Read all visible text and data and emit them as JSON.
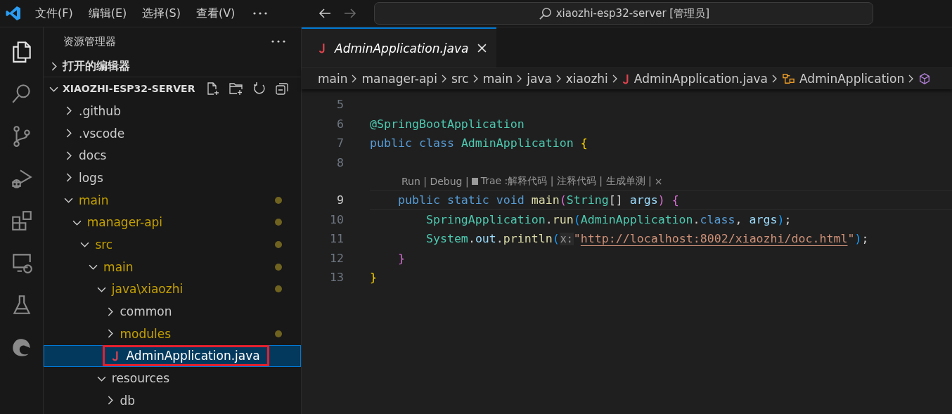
{
  "titlebar": {
    "menu": [
      "文件(F)",
      "编辑(E)",
      "选择(S)",
      "查看(V)"
    ],
    "search": {
      "value": "xiaozhi-esp32-server [管理员]"
    }
  },
  "activity_bar": [
    {
      "kind": "explorer",
      "selected": true
    },
    {
      "kind": "search",
      "selected": false
    },
    {
      "kind": "source-control",
      "selected": false
    },
    {
      "kind": "run-debug",
      "selected": false
    },
    {
      "kind": "extensions",
      "selected": false
    },
    {
      "kind": "remote",
      "selected": false
    },
    {
      "kind": "testing",
      "selected": false
    },
    {
      "kind": "edge",
      "selected": false
    }
  ],
  "explorer": {
    "title": "资源管理器",
    "open_editors": {
      "label": "打开的编辑器",
      "expanded": false
    },
    "workspace": {
      "label": "XIAOZHI-ESP32-SERVER",
      "expanded": true
    },
    "tree": [
      {
        "name": ".github",
        "kind": "folder",
        "expanded": false,
        "modified": false
      },
      {
        "name": ".vscode",
        "kind": "folder",
        "expanded": false,
        "modified": false
      },
      {
        "name": "docs",
        "kind": "folder",
        "expanded": false,
        "modified": false
      },
      {
        "name": "logs",
        "kind": "folder",
        "expanded": false,
        "modified": false
      },
      {
        "name": "main",
        "kind": "folder",
        "expanded": true,
        "modified": true,
        "children": [
          {
            "name": "manager-api",
            "kind": "folder",
            "expanded": true,
            "modified": true,
            "children": [
              {
                "name": "src",
                "kind": "folder",
                "expanded": true,
                "modified": true,
                "children": [
                  {
                    "name": "main",
                    "kind": "folder",
                    "expanded": true,
                    "modified": true,
                    "children": [
                      {
                        "name": "java\\xiaozhi",
                        "kind": "folder",
                        "expanded": true,
                        "modified": true,
                        "children": [
                          {
                            "name": "common",
                            "kind": "folder",
                            "expanded": false,
                            "modified": false
                          },
                          {
                            "name": "modules",
                            "kind": "folder",
                            "expanded": false,
                            "modified": true
                          },
                          {
                            "name": "AdminApplication.java",
                            "kind": "java-file",
                            "selected": true,
                            "highlighted": true
                          }
                        ]
                      },
                      {
                        "name": "resources",
                        "kind": "folder",
                        "expanded": true,
                        "modified": false,
                        "children": [
                          {
                            "name": "db",
                            "kind": "folder",
                            "expanded": false,
                            "modified": false
                          }
                        ]
                      }
                    ]
                  }
                ]
              }
            ]
          }
        ]
      }
    ]
  },
  "tabs": [
    {
      "label": "AdminApplication.java",
      "selected": true,
      "preview": true
    }
  ],
  "breadcrumbs": [
    {
      "label": "main",
      "kind": "folder"
    },
    {
      "label": "manager-api",
      "kind": "folder"
    },
    {
      "label": "src",
      "kind": "folder"
    },
    {
      "label": "main",
      "kind": "folder"
    },
    {
      "label": "java",
      "kind": "folder"
    },
    {
      "label": "xiaozhi",
      "kind": "folder"
    },
    {
      "label": "AdminApplication.java",
      "kind": "java-file"
    },
    {
      "label": "AdminApplication",
      "kind": "class"
    },
    {
      "kind": "method"
    }
  ],
  "editor": {
    "lines": [
      {
        "kind": "code",
        "number": "5",
        "current": false
      },
      {
        "kind": "code",
        "number": "6",
        "current": false,
        "tokens": [
          {
            "text": "@SpringBootApplication",
            "kind": "type"
          }
        ]
      },
      {
        "kind": "code",
        "number": "7",
        "current": false,
        "tokens": [
          {
            "text": "public class ",
            "kind": "keyword"
          },
          {
            "text": "AdminApplication ",
            "kind": "type"
          },
          {
            "text": "{",
            "kind": "brace1"
          }
        ]
      },
      {
        "kind": "code",
        "number": "8",
        "current": false
      },
      {
        "kind": "codelens",
        "parts": [
          "Run | Debug |",
          "Trae :解释代码 | 注释代码 | 生成单测 |"
        ],
        "close": "×"
      },
      {
        "kind": "code",
        "number": "9",
        "current": true,
        "tokens": [
          {
            "text": "    public static void ",
            "kind": "keyword"
          },
          {
            "text": "main",
            "kind": "func"
          },
          {
            "text": "(",
            "kind": "brace2"
          },
          {
            "text": "String",
            "kind": "type"
          },
          {
            "text": "[] ",
            "kind": "plain"
          },
          {
            "text": "args",
            "kind": "var"
          },
          {
            "text": ") ",
            "kind": "brace2"
          },
          {
            "text": "{",
            "kind": "brace2"
          }
        ]
      },
      {
        "kind": "code",
        "number": "10",
        "current": false,
        "tokens": [
          {
            "text": "        SpringApplication",
            "kind": "type"
          },
          {
            "text": ".",
            "kind": "plain"
          },
          {
            "text": "run",
            "kind": "func"
          },
          {
            "text": "(",
            "kind": "brace3"
          },
          {
            "text": "AdminApplication",
            "kind": "type"
          },
          {
            "text": ".",
            "kind": "plain"
          },
          {
            "text": "class",
            "kind": "keyword"
          },
          {
            "text": ", ",
            "kind": "plain"
          },
          {
            "text": "args",
            "kind": "var"
          },
          {
            "text": ")",
            "kind": "brace3"
          },
          {
            "text": ";",
            "kind": "plain"
          }
        ]
      },
      {
        "kind": "code",
        "number": "11",
        "current": false,
        "tokens": [
          {
            "text": "        System",
            "kind": "type"
          },
          {
            "text": ".",
            "kind": "plain"
          },
          {
            "text": "out",
            "kind": "var"
          },
          {
            "text": ".",
            "kind": "plain"
          },
          {
            "text": "println",
            "kind": "func"
          },
          {
            "text": "(",
            "kind": "brace3"
          },
          {
            "text": "x:",
            "kind": "hint"
          },
          {
            "text": "\"",
            "kind": "string"
          },
          {
            "text": "http://localhost:8002/xiaozhi/doc.html",
            "kind": "link"
          },
          {
            "text": "\"",
            "kind": "string"
          },
          {
            "text": ")",
            "kind": "brace3"
          },
          {
            "text": ";",
            "kind": "plain"
          }
        ]
      },
      {
        "kind": "code",
        "number": "12",
        "current": false,
        "tokens": [
          {
            "text": "    }",
            "kind": "brace2"
          }
        ]
      },
      {
        "kind": "code",
        "number": "13",
        "current": false,
        "tokens": [
          {
            "text": "}",
            "kind": "brace1"
          }
        ]
      }
    ]
  }
}
